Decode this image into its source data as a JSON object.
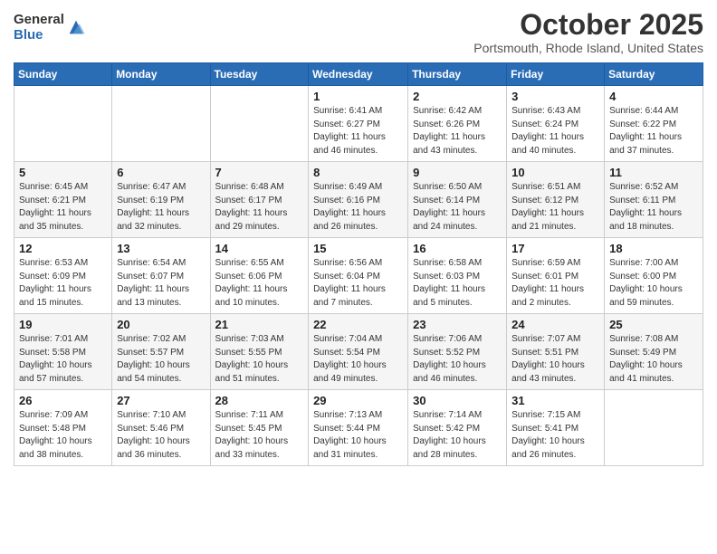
{
  "header": {
    "logo_general": "General",
    "logo_blue": "Blue",
    "month_title": "October 2025",
    "location": "Portsmouth, Rhode Island, United States"
  },
  "days_of_week": [
    "Sunday",
    "Monday",
    "Tuesday",
    "Wednesday",
    "Thursday",
    "Friday",
    "Saturday"
  ],
  "weeks": [
    [
      {
        "num": "",
        "info": ""
      },
      {
        "num": "",
        "info": ""
      },
      {
        "num": "",
        "info": ""
      },
      {
        "num": "1",
        "info": "Sunrise: 6:41 AM\nSunset: 6:27 PM\nDaylight: 11 hours and 46 minutes."
      },
      {
        "num": "2",
        "info": "Sunrise: 6:42 AM\nSunset: 6:26 PM\nDaylight: 11 hours and 43 minutes."
      },
      {
        "num": "3",
        "info": "Sunrise: 6:43 AM\nSunset: 6:24 PM\nDaylight: 11 hours and 40 minutes."
      },
      {
        "num": "4",
        "info": "Sunrise: 6:44 AM\nSunset: 6:22 PM\nDaylight: 11 hours and 37 minutes."
      }
    ],
    [
      {
        "num": "5",
        "info": "Sunrise: 6:45 AM\nSunset: 6:21 PM\nDaylight: 11 hours and 35 minutes."
      },
      {
        "num": "6",
        "info": "Sunrise: 6:47 AM\nSunset: 6:19 PM\nDaylight: 11 hours and 32 minutes."
      },
      {
        "num": "7",
        "info": "Sunrise: 6:48 AM\nSunset: 6:17 PM\nDaylight: 11 hours and 29 minutes."
      },
      {
        "num": "8",
        "info": "Sunrise: 6:49 AM\nSunset: 6:16 PM\nDaylight: 11 hours and 26 minutes."
      },
      {
        "num": "9",
        "info": "Sunrise: 6:50 AM\nSunset: 6:14 PM\nDaylight: 11 hours and 24 minutes."
      },
      {
        "num": "10",
        "info": "Sunrise: 6:51 AM\nSunset: 6:12 PM\nDaylight: 11 hours and 21 minutes."
      },
      {
        "num": "11",
        "info": "Sunrise: 6:52 AM\nSunset: 6:11 PM\nDaylight: 11 hours and 18 minutes."
      }
    ],
    [
      {
        "num": "12",
        "info": "Sunrise: 6:53 AM\nSunset: 6:09 PM\nDaylight: 11 hours and 15 minutes."
      },
      {
        "num": "13",
        "info": "Sunrise: 6:54 AM\nSunset: 6:07 PM\nDaylight: 11 hours and 13 minutes."
      },
      {
        "num": "14",
        "info": "Sunrise: 6:55 AM\nSunset: 6:06 PM\nDaylight: 11 hours and 10 minutes."
      },
      {
        "num": "15",
        "info": "Sunrise: 6:56 AM\nSunset: 6:04 PM\nDaylight: 11 hours and 7 minutes."
      },
      {
        "num": "16",
        "info": "Sunrise: 6:58 AM\nSunset: 6:03 PM\nDaylight: 11 hours and 5 minutes."
      },
      {
        "num": "17",
        "info": "Sunrise: 6:59 AM\nSunset: 6:01 PM\nDaylight: 11 hours and 2 minutes."
      },
      {
        "num": "18",
        "info": "Sunrise: 7:00 AM\nSunset: 6:00 PM\nDaylight: 10 hours and 59 minutes."
      }
    ],
    [
      {
        "num": "19",
        "info": "Sunrise: 7:01 AM\nSunset: 5:58 PM\nDaylight: 10 hours and 57 minutes."
      },
      {
        "num": "20",
        "info": "Sunrise: 7:02 AM\nSunset: 5:57 PM\nDaylight: 10 hours and 54 minutes."
      },
      {
        "num": "21",
        "info": "Sunrise: 7:03 AM\nSunset: 5:55 PM\nDaylight: 10 hours and 51 minutes."
      },
      {
        "num": "22",
        "info": "Sunrise: 7:04 AM\nSunset: 5:54 PM\nDaylight: 10 hours and 49 minutes."
      },
      {
        "num": "23",
        "info": "Sunrise: 7:06 AM\nSunset: 5:52 PM\nDaylight: 10 hours and 46 minutes."
      },
      {
        "num": "24",
        "info": "Sunrise: 7:07 AM\nSunset: 5:51 PM\nDaylight: 10 hours and 43 minutes."
      },
      {
        "num": "25",
        "info": "Sunrise: 7:08 AM\nSunset: 5:49 PM\nDaylight: 10 hours and 41 minutes."
      }
    ],
    [
      {
        "num": "26",
        "info": "Sunrise: 7:09 AM\nSunset: 5:48 PM\nDaylight: 10 hours and 38 minutes."
      },
      {
        "num": "27",
        "info": "Sunrise: 7:10 AM\nSunset: 5:46 PM\nDaylight: 10 hours and 36 minutes."
      },
      {
        "num": "28",
        "info": "Sunrise: 7:11 AM\nSunset: 5:45 PM\nDaylight: 10 hours and 33 minutes."
      },
      {
        "num": "29",
        "info": "Sunrise: 7:13 AM\nSunset: 5:44 PM\nDaylight: 10 hours and 31 minutes."
      },
      {
        "num": "30",
        "info": "Sunrise: 7:14 AM\nSunset: 5:42 PM\nDaylight: 10 hours and 28 minutes."
      },
      {
        "num": "31",
        "info": "Sunrise: 7:15 AM\nSunset: 5:41 PM\nDaylight: 10 hours and 26 minutes."
      },
      {
        "num": "",
        "info": ""
      }
    ]
  ]
}
